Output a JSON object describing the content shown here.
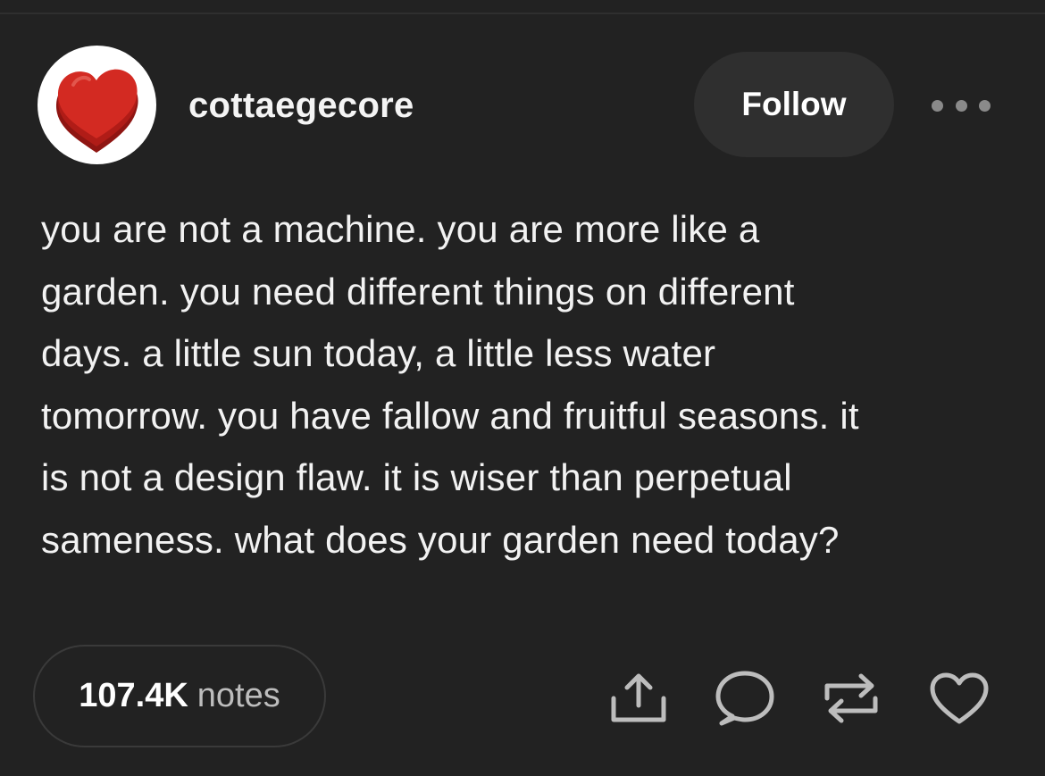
{
  "post": {
    "author": {
      "username": "cottaegecore"
    },
    "follow_label": "Follow",
    "body_lines": [
      "you are not a machine. you are more like a",
      "garden. you need different things on different",
      "days. a little sun today, a little less water",
      "tomorrow. you have fallow and fruitful seasons. it",
      "is not a design flaw. it is wiser than perpetual",
      "sameness. what does your garden need today?"
    ],
    "notes": {
      "count": "107.4K",
      "label": "notes"
    },
    "actions": {
      "share_icon": "share-icon",
      "reply_icon": "comment-bubble-icon",
      "reblog_icon": "reblog-icon",
      "like_icon": "heart-icon"
    }
  },
  "colors": {
    "background": "#222222",
    "button_bg": "#2f2f2f",
    "text": "#f2f2f2",
    "muted": "#bdbdbd",
    "icon": "#bdbdbd",
    "avatar_heart": "#c8231e"
  }
}
